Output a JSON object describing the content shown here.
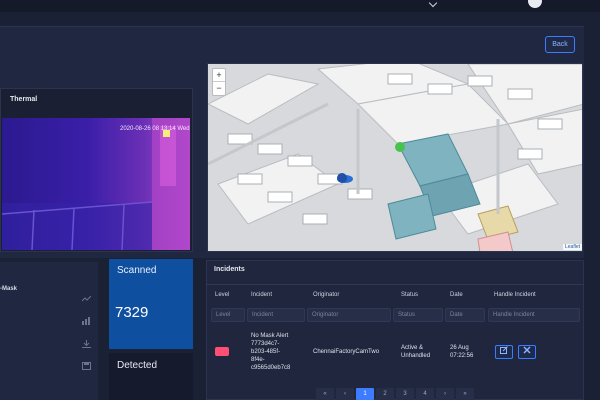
{
  "header": {
    "caret_icon": "chevron-down-icon",
    "avatar_icon": "user-avatar"
  },
  "top_panel": {
    "back_label": "Back"
  },
  "thermal": {
    "title": "Thermal",
    "timestamp": "2020-08-26 08 13:14 Wed"
  },
  "map": {
    "zoom_in": "+",
    "zoom_out": "−",
    "attribution": "Leaflet"
  },
  "left_panel": {
    "mask_label": "-Mask",
    "icons": [
      "line-chart-icon",
      "bar-chart-icon",
      "download-icon",
      "save-icon"
    ]
  },
  "stats": {
    "scanned_label": "Scanned",
    "scanned_value": "7329",
    "detected_label": "Detected"
  },
  "incidents": {
    "title": "Incidents",
    "columns": [
      "Level",
      "Incident",
      "Originator",
      "Status",
      "Date",
      "Handle Incident"
    ],
    "filters": [
      "Level",
      "Incident",
      "Originator",
      "Status",
      "Date",
      "Handle Incident"
    ],
    "rows": [
      {
        "level": "",
        "incident_title": "No Mask Alert",
        "incident_id_1": "7773d4c7-",
        "incident_id_2": "b203-485f-",
        "incident_id_3": "8f4e-",
        "incident_id_4": "c9565d0eb7c8",
        "originator": "ChennaiFactoryCamTwo",
        "status_1": "Active &",
        "status_2": "Unhandled",
        "date_1": "26 Aug",
        "date_2": "07:22:56"
      }
    ],
    "actions": {
      "edit_icon": "edit-icon",
      "close_icon": "close-icon"
    },
    "pagination": [
      "«",
      "‹",
      "1",
      "2",
      "3",
      "4",
      "›",
      "»"
    ],
    "active_page": "1"
  },
  "colors": {
    "background": "#1b2134",
    "accent": "#3d7cff",
    "scanned": "#0f4f9f",
    "alert": "#ff4f74"
  }
}
